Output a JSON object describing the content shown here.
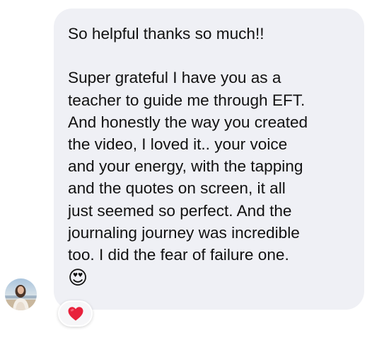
{
  "message": {
    "lines": [
      "So helpful thanks so much!!",
      "Super grateful I have you as a",
      "teacher to guide me through EFT.",
      "And honestly the way you created",
      "the video, I loved it.. your voice",
      "and your energy, with the tapping",
      "and the quotes on screen, it all",
      "just seemed so perfect. And the",
      "journaling journey was incredible",
      "too. I did the fear of failure one."
    ],
    "emoji": "😍"
  },
  "reaction": {
    "icon": "red-heart-icon"
  },
  "colors": {
    "bubble": "#eff0f5",
    "text": "#111111",
    "heart": "#e8213b",
    "reaction_bg": "#f6f6f8"
  }
}
